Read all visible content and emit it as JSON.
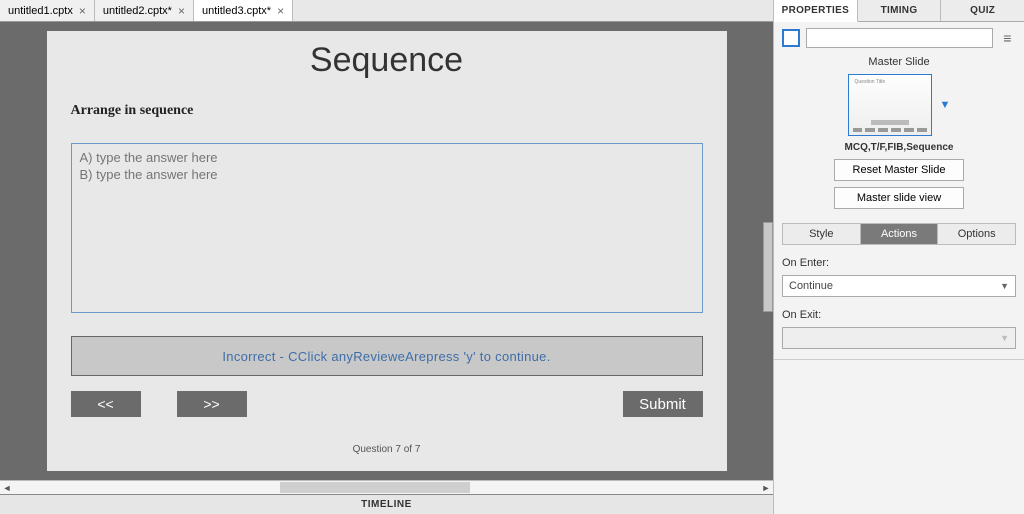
{
  "tabs": [
    {
      "label": "untitled1.cptx"
    },
    {
      "label": "untitled2.cptx*"
    },
    {
      "label": "untitled3.cptx*"
    }
  ],
  "active_tab": 2,
  "slide": {
    "title": "Sequence",
    "question": "Arrange in sequence",
    "answers": [
      "A) type the answer here",
      "B) type the answer here"
    ],
    "review_text": "Incorrect - CClick anyRevieweArepress 'y' to continue.",
    "prev": "<<",
    "next": ">>",
    "submit": "Submit",
    "footer": "Question 7 of 7"
  },
  "timeline_label": "TIMELINE",
  "panel": {
    "tabs": {
      "properties": "PROPERTIES",
      "timing": "TIMING",
      "quiz": "QUIZ"
    },
    "name_value": "",
    "master_slide_label": "Master Slide",
    "master_caption": "MCQ,T/F,FIB,Sequence",
    "reset_btn": "Reset Master Slide",
    "view_btn": "Master slide view",
    "sub_tabs": {
      "style": "Style",
      "actions": "Actions",
      "options": "Options"
    },
    "on_enter_label": "On Enter:",
    "on_enter_value": "Continue",
    "on_exit_label": "On Exit:",
    "on_exit_value": ""
  }
}
